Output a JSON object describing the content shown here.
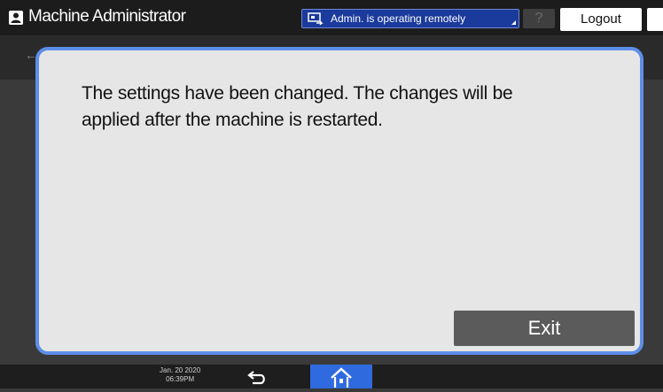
{
  "header": {
    "user_label": "Machine Administrator",
    "remote_status": "Admin. is operating remotely",
    "help_label": "?",
    "logout_label": "Logout",
    "icons": {
      "user": "user-icon",
      "remote": "remote-operation-icon",
      "sleep": "moon-icon"
    }
  },
  "dialog": {
    "message": "The settings have been changed. The changes will be applied after the machine is restarted.",
    "exit_label": "Exit"
  },
  "footer": {
    "date": "Jan. 20 2020",
    "time": "06:39PM",
    "icons": {
      "return": "return-arrow-icon",
      "home": "home-icon"
    }
  },
  "colors": {
    "accent": "#2f6bdf",
    "dialog_border": "#5d8fe8",
    "remote_banner": "#1a3a9c"
  }
}
